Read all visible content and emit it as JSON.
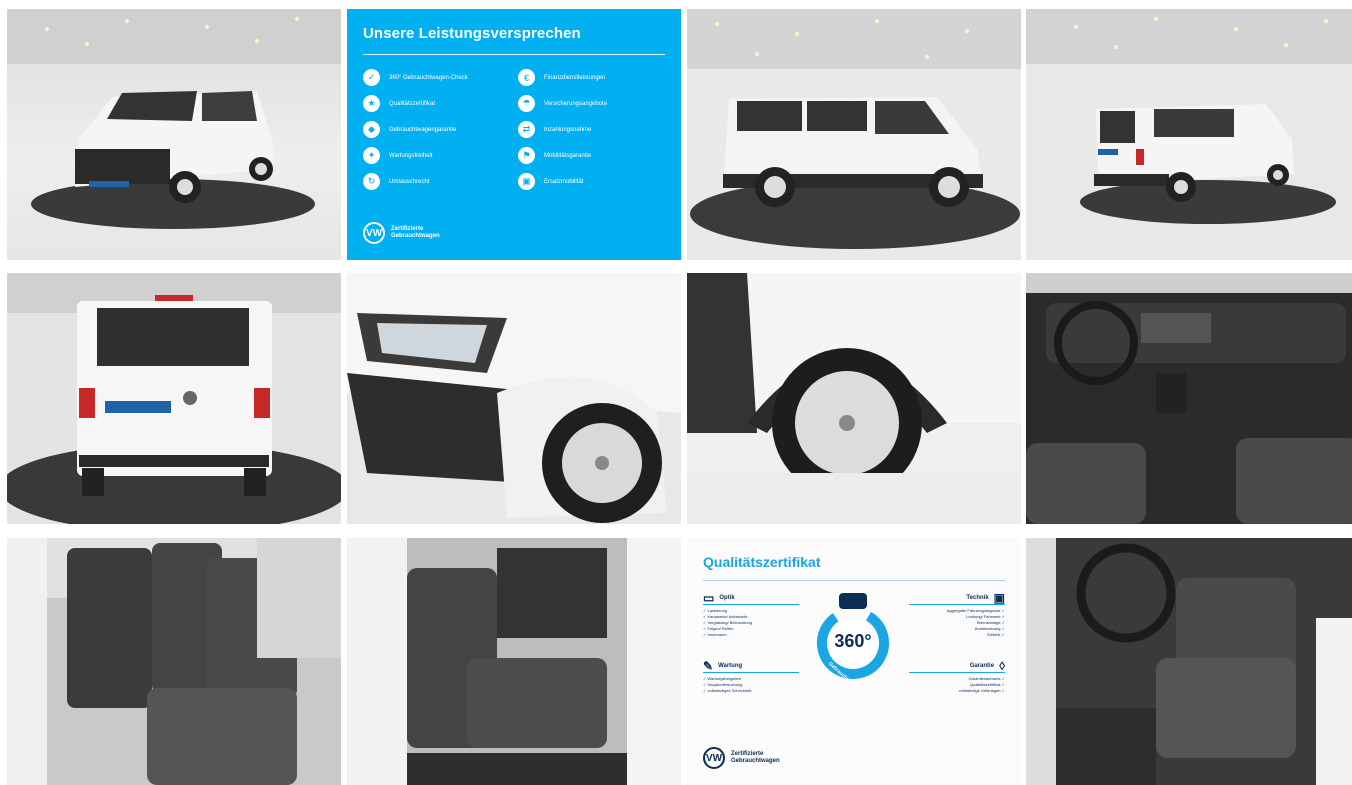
{
  "gallery": {
    "photos": [
      {
        "name": "photo-front-left"
      },
      {
        "name": "photo-side"
      },
      {
        "name": "photo-rear-left"
      },
      {
        "name": "photo-rear"
      },
      {
        "name": "photo-headlight"
      },
      {
        "name": "photo-wheel"
      },
      {
        "name": "photo-dashboard"
      },
      {
        "name": "photo-rear-seats"
      },
      {
        "name": "photo-passenger-seat"
      },
      {
        "name": "photo-front-seats"
      }
    ]
  },
  "promise_card": {
    "title": "Unsere Leistungsversprechen",
    "items_left": [
      {
        "icon": "check-icon",
        "label": "360° Gebrauchtwagen-Check"
      },
      {
        "icon": "certificate-icon",
        "label": "Qualitätszertifikat"
      },
      {
        "icon": "shield-icon",
        "label": "Gebrauchtwagengarantie"
      },
      {
        "icon": "wrench-icon",
        "label": "Wartungsfreiheit"
      },
      {
        "icon": "exchange-icon",
        "label": "Umtauschrecht"
      }
    ],
    "items_right": [
      {
        "icon": "finance-icon",
        "label": "Finanzdienstleistungen"
      },
      {
        "icon": "insurance-icon",
        "label": "Versicherungsangebote"
      },
      {
        "icon": "tradein-icon",
        "label": "Inzahlungsnahme"
      },
      {
        "icon": "warranty-icon",
        "label": "Mobilitätsgarantie"
      },
      {
        "icon": "car-icon",
        "label": "Ersatzmobilität"
      }
    ],
    "brand_line1": "Zertifizierte",
    "brand_line2": "Gebrauchtwagen",
    "logo": "VW"
  },
  "quality_card": {
    "title": "Qualitätszertifikat",
    "gauge_value": "360°",
    "gauge_label": "Gebrauchtwagen-Check",
    "optik": {
      "title": "Optik",
      "items": [
        "✓ Lackierung",
        "✓ Karosserie/ Anbauteile",
        "✓ Verglasung/ Beleuchtung",
        "✓ Felgen/ Reifen",
        "✓ Innenraum"
      ]
    },
    "wartung": {
      "title": "Wartung",
      "items": [
        "✓ Wartungsfreigaben",
        "✓ Hauptuntersuchung",
        "✓ vollständiges Scheckheft"
      ]
    },
    "technik": {
      "title": "Technik",
      "items": [
        "Aggregate/ Fahrzeugdiagnose ✓",
        "Lenkung/ Fahrwerk ✓",
        "Bremsanlage ✓",
        "Antriebsstrang ✓",
        "Elektrik ✓"
      ]
    },
    "garantie": {
      "title": "Garantie",
      "items": [
        "Garantienachweis ✓",
        "Qualitätszertifikat ✓",
        "vollständige Unterlagen ✓"
      ]
    },
    "brand_line1": "Zertifizierte",
    "brand_line2": "Gebrauchtwagen",
    "logo": "VW"
  },
  "colors": {
    "promise_bg": "#00b0f0",
    "quality_accent": "#1aa5e3",
    "navy": "#0a2e56"
  }
}
